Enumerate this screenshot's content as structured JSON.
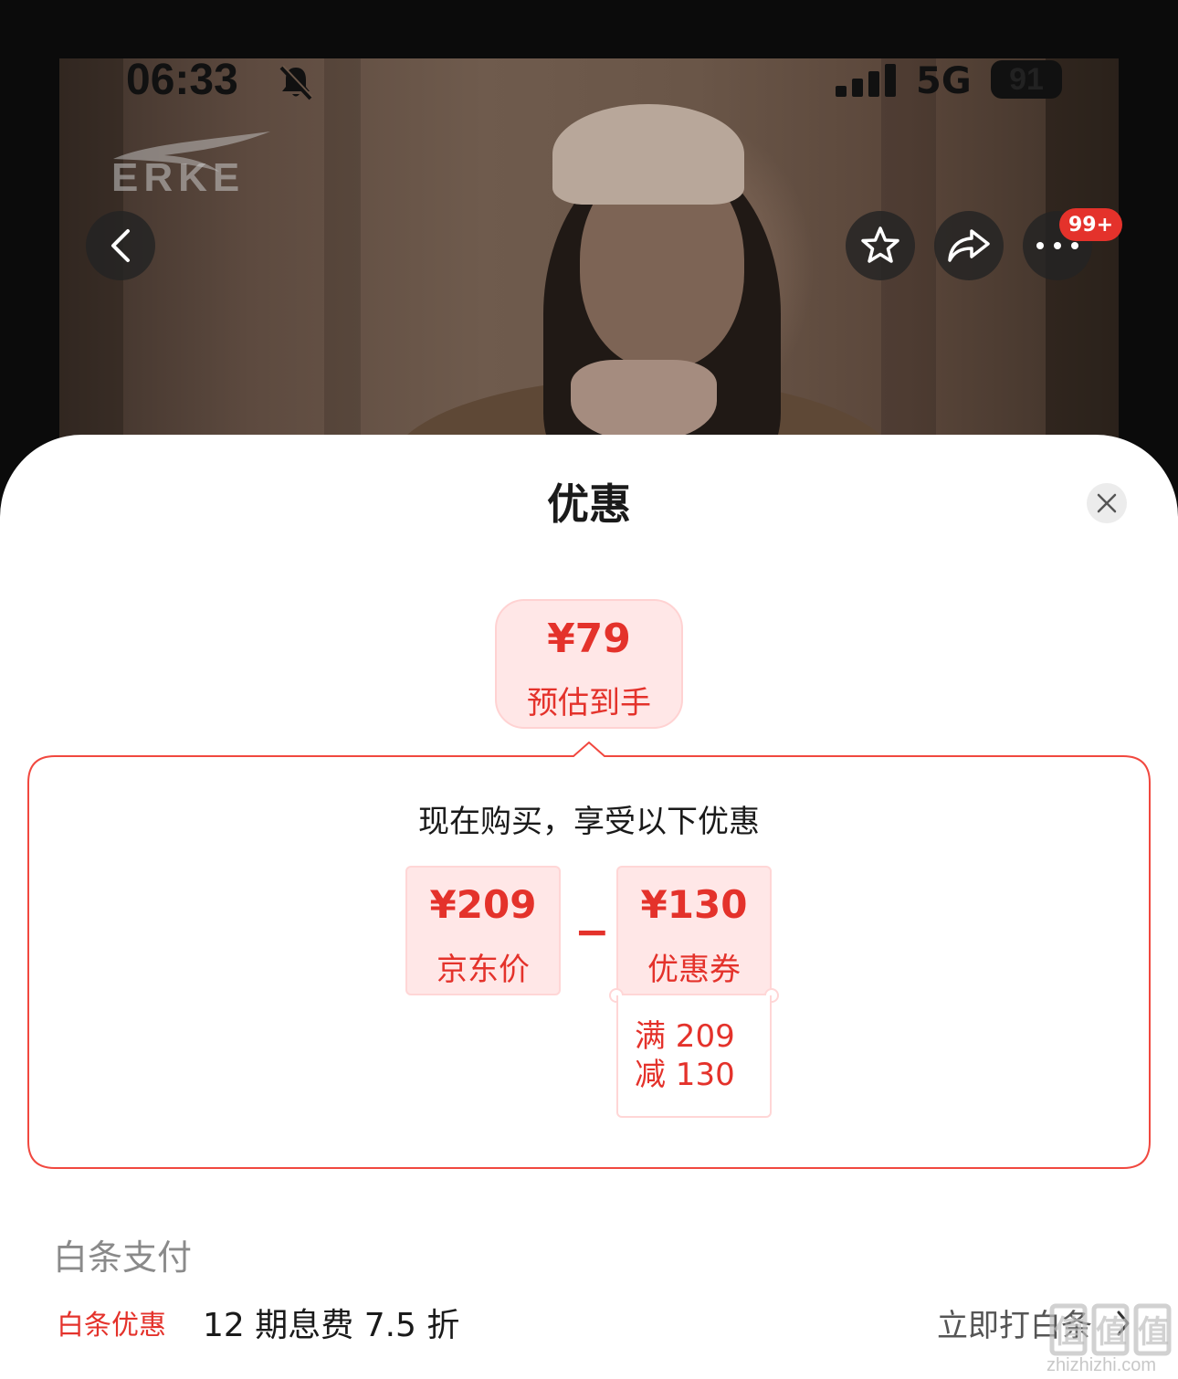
{
  "status_bar": {
    "time": "06:33",
    "network": "5G",
    "battery": "91"
  },
  "header": {
    "brand": "ERKE",
    "badge": "99+",
    "icons": [
      "chevron-left-icon",
      "star-icon",
      "share-icon",
      "more-icon"
    ]
  },
  "sheet": {
    "title": "优惠",
    "estimate": {
      "price": "¥79",
      "label": "预估到手"
    },
    "offer_heading": "现在购买，享受以下优惠",
    "jd_price": {
      "amount": "¥209",
      "label": "京东价"
    },
    "minus": "−",
    "coupon": {
      "amount": "¥130",
      "label": "优惠券",
      "detail_line1": "满 209",
      "detail_line2": "减 130"
    },
    "baitiao": {
      "title": "白条支付",
      "tag": "白条优惠",
      "desc": "12 期息费 7.5 折",
      "action": "立即打白条"
    }
  },
  "watermark": {
    "url": "zhizhizhi.com",
    "logo_text": "值"
  },
  "colors": {
    "accent": "#e4322b",
    "accent_bg": "#ffe7e7"
  }
}
